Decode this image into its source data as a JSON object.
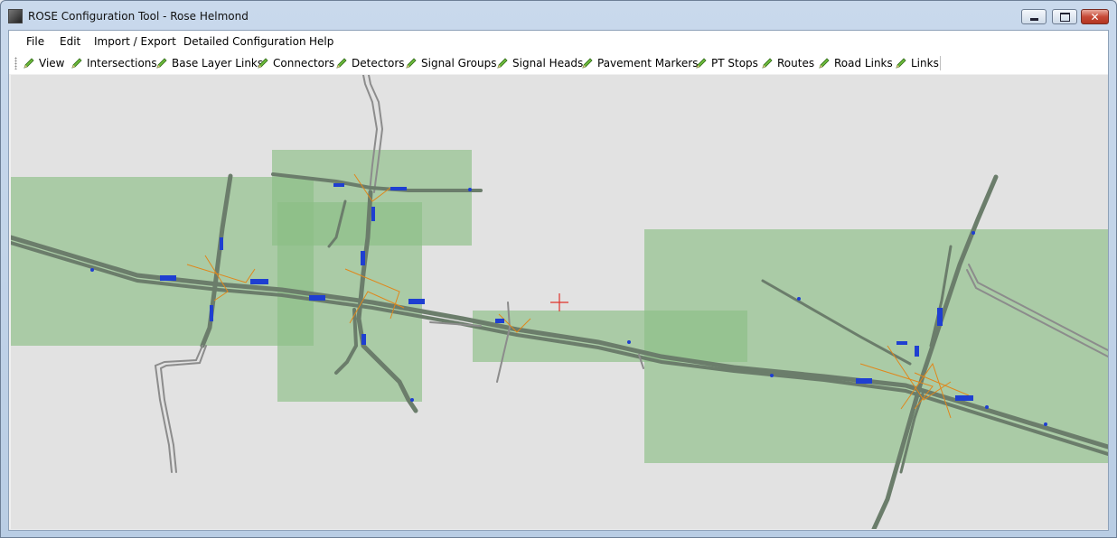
{
  "window": {
    "title": "ROSE Configuration Tool - Rose Helmond",
    "minimize_glyph": "",
    "close_glyph": "✕"
  },
  "menu": {
    "items": [
      "File",
      "Edit",
      "Import / Export",
      "Detailed Configuration",
      "Help"
    ]
  },
  "toolbar": {
    "items": [
      "View",
      "Intersections",
      "Base Layer Links",
      "Connectors",
      "Detectors",
      "Signal Groups",
      "Signal Heads",
      "Pavement Markers",
      "PT Stops",
      "Routes",
      "Road Links",
      "Links"
    ],
    "icon": "pencil-icon"
  },
  "colors": {
    "area_fill": "#8cbf85",
    "road": "#6b7d6b",
    "detector": "#1f3fd1",
    "connector": "#e0871b",
    "cursor": "#e0312a",
    "map_bg": "#e2e2e2"
  },
  "map": {
    "cursor_icon": "crosshair-cursor-icon"
  }
}
